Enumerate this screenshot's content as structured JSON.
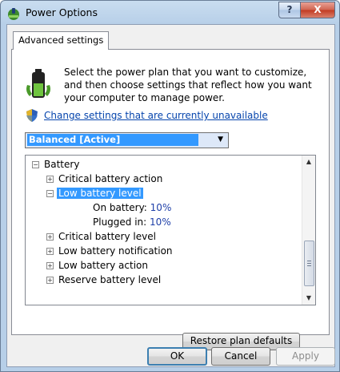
{
  "window": {
    "title": "Power Options",
    "help_label": "?",
    "close_label": "X"
  },
  "tabs": [
    {
      "label": "Advanced settings"
    }
  ],
  "intro": {
    "text": "Select the power plan that you want to customize, and then choose settings that reflect how you want your computer to manage power."
  },
  "link": {
    "label": "Change settings that are currently unavailable"
  },
  "plan_select": {
    "value": "Balanced [Active]"
  },
  "tree": {
    "items": [
      {
        "label": "Battery",
        "expander": "−"
      },
      {
        "label": "Critical battery action",
        "expander": "+"
      },
      {
        "label": "Low battery level",
        "expander": "−"
      },
      {
        "label": "On battery:",
        "value": "10%"
      },
      {
        "label": "Plugged in:",
        "value": "10%"
      },
      {
        "label": "Critical battery level",
        "expander": "+"
      },
      {
        "label": "Low battery notification",
        "expander": "+"
      },
      {
        "label": "Low battery action",
        "expander": "+"
      },
      {
        "label": "Reserve battery level",
        "expander": "+"
      }
    ]
  },
  "buttons": {
    "restore": "Restore plan defaults",
    "ok": "OK",
    "cancel": "Cancel",
    "apply": "Apply"
  }
}
